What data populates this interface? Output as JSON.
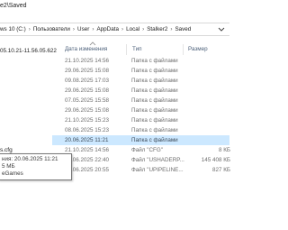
{
  "window": {
    "title_fragment": "e2\\Saved"
  },
  "address": {
    "crumbs": [
      "ws 10 (C:)",
      "Пользователи",
      "User",
      "AppData",
      "Local",
      "Stalker2",
      "Saved"
    ]
  },
  "sidebar": {
    "visible_label": "05.10.21-11.56.05.622"
  },
  "columns": {
    "date": "Дата изменения",
    "type": "Тип",
    "size": "Размер"
  },
  "rows": [
    {
      "date": "21.10.2025 14:56",
      "type": "Папка с файлами",
      "size": "",
      "selected": false
    },
    {
      "date": "29.06.2025 15:08",
      "type": "Папка с файлами",
      "size": "",
      "selected": false
    },
    {
      "date": "09.08.2025 17:03",
      "type": "Папка с файлами",
      "size": "",
      "selected": false
    },
    {
      "date": "29.06.2025 15:08",
      "type": "Папка с файлами",
      "size": "",
      "selected": false
    },
    {
      "date": "07.05.2025 15:58",
      "type": "Папка с файлами",
      "size": "",
      "selected": false
    },
    {
      "date": "29.06.2025 15:08",
      "type": "Папка с файлами",
      "size": "",
      "selected": false
    },
    {
      "date": "21.10.2025 15:23",
      "type": "Папка с файлами",
      "size": "",
      "selected": false
    },
    {
      "date": "08.06.2025 15:23",
      "type": "Папка с файлами",
      "size": "",
      "selected": false
    },
    {
      "date": "20.06.2025 11:21",
      "type": "Папка с файлами",
      "size": "",
      "selected": true
    },
    {
      "date": "21.10.2025 14:56",
      "type": "Файл \"CFG\"",
      "size": "8 КБ",
      "selected": false
    },
    {
      "date": "28.06.2025 22:40",
      "type": "Файл \"USHADERP...",
      "size": "145 408 КБ",
      "selected": false
    },
    {
      "date": "26.06.2025 20:55",
      "type": "Файл \"UPIPELINE...",
      "size": "827 КБ",
      "selected": false
    }
  ],
  "left_file": {
    "name": "s.cfg"
  },
  "tooltip": {
    "line1": "ния: 20.06.2025 11:21",
    "line2": "5 МБ",
    "line3": "eGames"
  },
  "colors": {
    "selection": "#cce8ff",
    "header_text": "#4c607a"
  }
}
